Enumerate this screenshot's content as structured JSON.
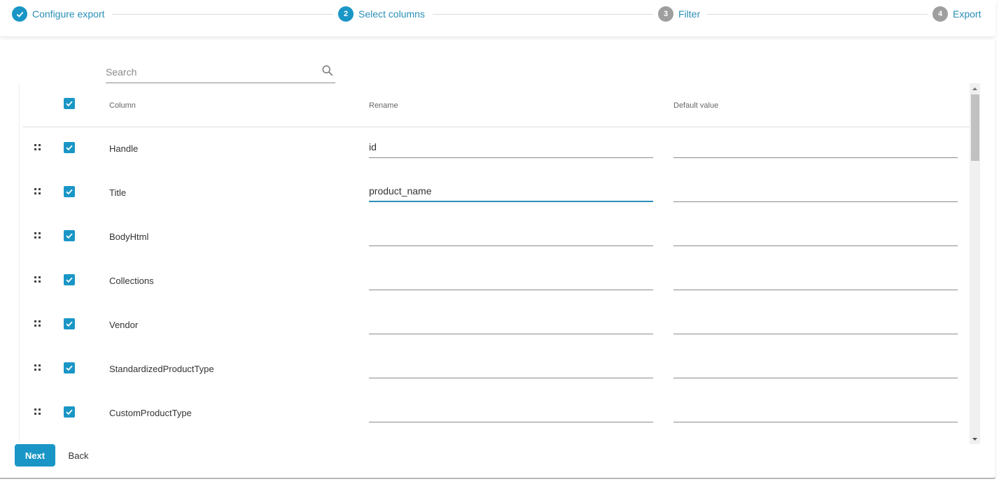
{
  "stepper": {
    "steps": [
      {
        "number": "1",
        "label": "Configure export",
        "state": "done",
        "icon": "check-icon"
      },
      {
        "number": "2",
        "label": "Select columns",
        "state": "active"
      },
      {
        "number": "3",
        "label": "Filter",
        "state": "pending"
      },
      {
        "number": "4",
        "label": "Export",
        "state": "pending"
      }
    ]
  },
  "search": {
    "placeholder": "Search",
    "value": "",
    "icon": "search-icon"
  },
  "table": {
    "select_all_checked": true,
    "headers": {
      "column": "Column",
      "rename": "Rename",
      "default_value": "Default value"
    },
    "rows": [
      {
        "column": "Handle",
        "checked": true,
        "rename": "id",
        "default_value": ""
      },
      {
        "column": "Title",
        "checked": true,
        "rename": "product_name",
        "default_value": "",
        "focused": true
      },
      {
        "column": "BodyHtml",
        "checked": true,
        "rename": "",
        "default_value": ""
      },
      {
        "column": "Collections",
        "checked": true,
        "rename": "",
        "default_value": ""
      },
      {
        "column": "Vendor",
        "checked": true,
        "rename": "",
        "default_value": ""
      },
      {
        "column": "StandardizedProductType",
        "checked": true,
        "rename": "",
        "default_value": ""
      },
      {
        "column": "CustomProductType",
        "checked": true,
        "rename": "",
        "default_value": ""
      }
    ]
  },
  "footer": {
    "next_label": "Next",
    "back_label": "Back"
  },
  "colors": {
    "accent": "#1a96c6",
    "step_label": "#2a8fb6",
    "pending_step": "#9e9e9e"
  }
}
